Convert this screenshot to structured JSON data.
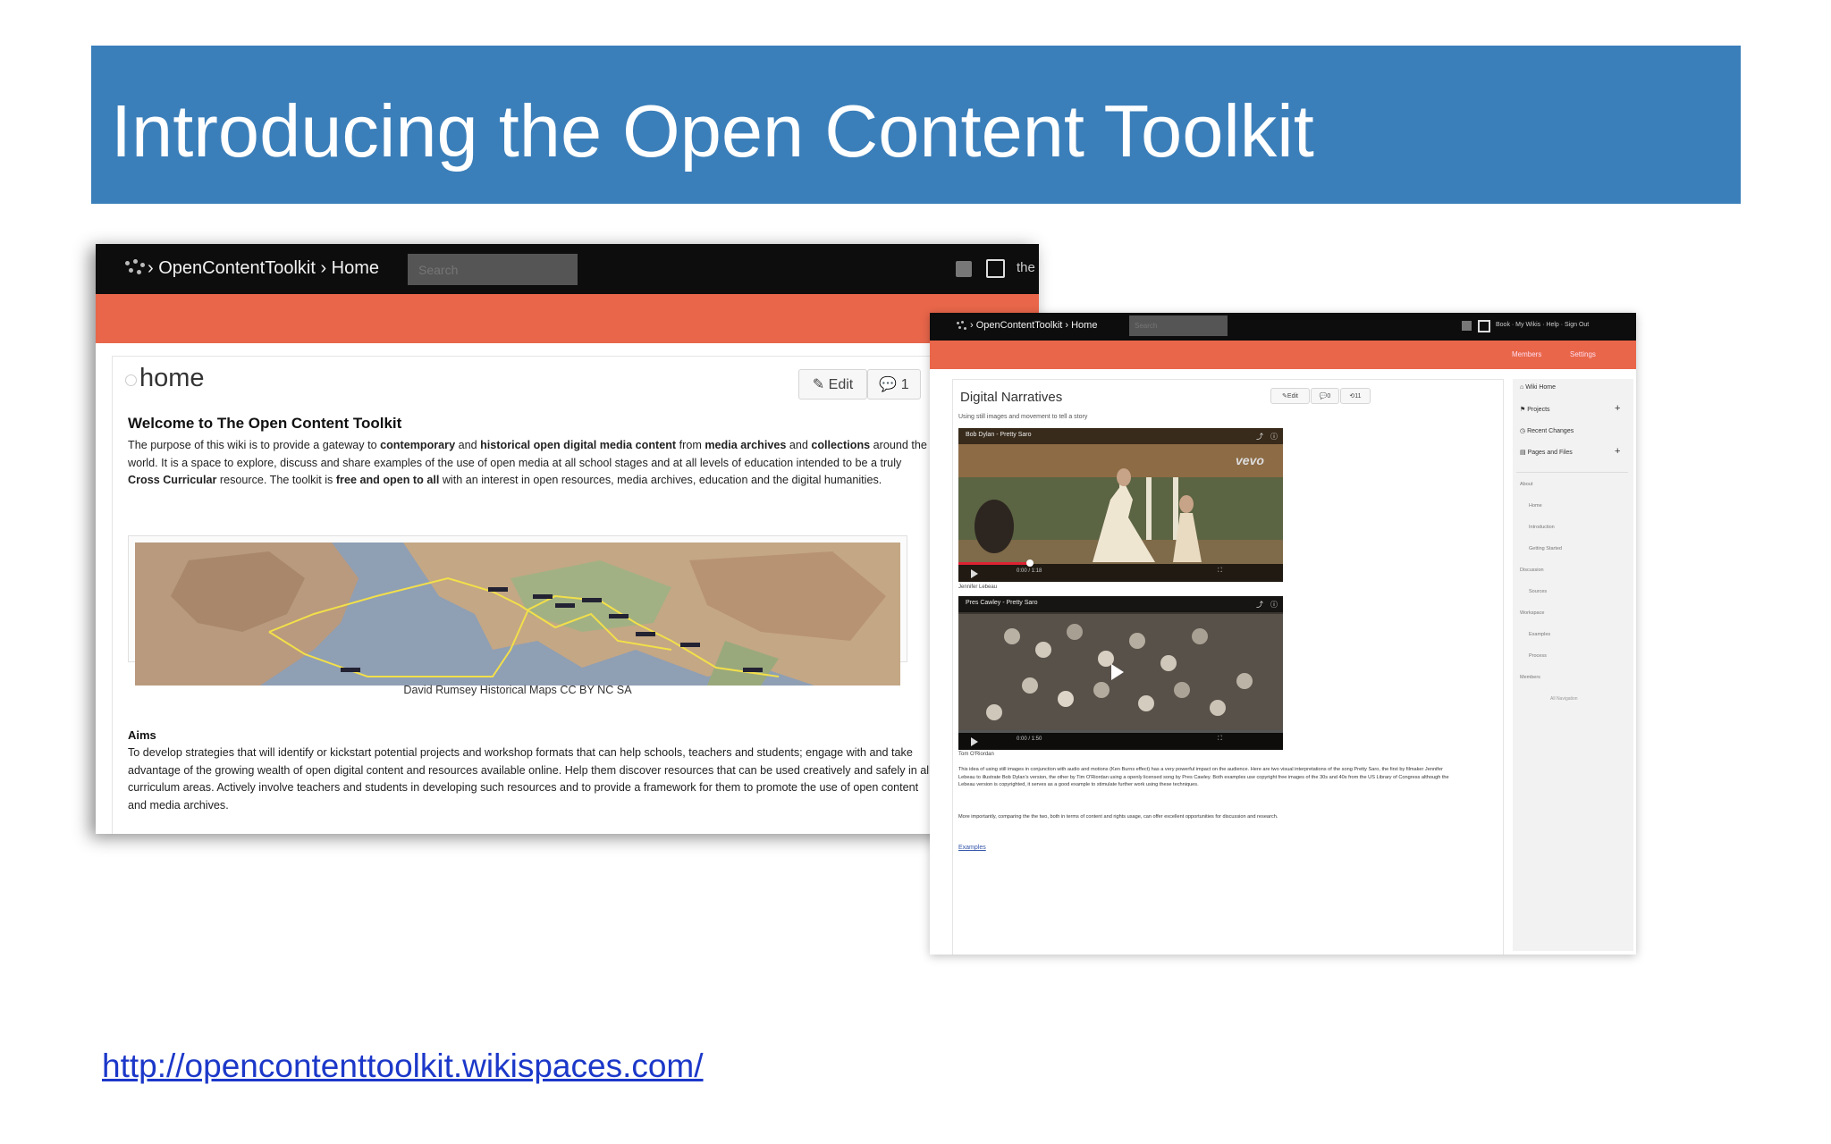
{
  "slide": {
    "title": "Introducing the Open Content Toolkit",
    "link_url": "http://opencontenttoolkit.wikispaces.com/"
  },
  "colors": {
    "title_bar": "#3b7fba",
    "nav_bar": "#0d0d0d",
    "accent_orange": "#e9664a",
    "link_blue": "#1c38c9"
  },
  "screenshot_home": {
    "breadcrumb": "› OpenContentToolkit › Home",
    "search_placeholder": "Search",
    "nav_user": "the",
    "page_title": "home",
    "edit_label": "Edit",
    "comments_count": "1",
    "welcome_heading": "Welcome to The Open Content Toolkit",
    "intro": {
      "p1": "The purpose of this wiki is to provide a gateway to ",
      "b1": "contemporary",
      "p2": " and ",
      "b2": "historical open digital media content",
      "p3": " from ",
      "b3": "media archives",
      "p4": " and ",
      "b4": "collections",
      "p5": " around the world. It is a space to explore, discuss and share examples of the use of open media at all school stages and at all levels of education intended to be a truly ",
      "b5": "Cross Curricular",
      "p6": " resource. The toolkit is ",
      "b6": "free and open to all",
      "p7": " with an interest in open resources, media archives, education and the digital humanities."
    },
    "map_caption": "David Rumsey Historical Maps CC BY NC SA",
    "aims_heading": "Aims",
    "aims_text": "To develop strategies that will identify or kickstart potential projects and workshop formats that can help schools, teachers and students; engage with and take advantage of the growing wealth of open digital content and resources available online. Help them discover resources that can be used creatively and safely in all curriculum areas. Actively involve teachers and students in developing such resources and to provide a framework for them to promote the use of open content and media archives."
  },
  "screenshot_narratives": {
    "breadcrumb": "› OpenContentToolkit › Home",
    "search_placeholder": "Search",
    "nav_links": "Book · My Wikis · Help · Sign Out",
    "orange_links": [
      "Members",
      "Settings"
    ],
    "page_title": "Digital Narratives",
    "subtitle": "Using still images and movement to tell a story",
    "edit_label": "Edit",
    "comments_count": "0",
    "history_count": "11",
    "video1": {
      "title": "Bob Dylan - Pretty Saro",
      "time": "0:00 / 1:18",
      "watermark": "vevo",
      "credit": "Jennifer Lebeau"
    },
    "video2": {
      "title": "Pres Cawley - Pretty Saro",
      "time": "0:00 / 1:50",
      "credit": "Tom O'Riordan"
    },
    "body_text1": "This idea of using still images in conjunction with audio and motions (Ken Burns effect) has a very powerful impact on the audience. Here are two visual interpretations of the song Pretty Saro, the first by filmaker Jennifer Lebeau to illustrate Bob Dylan's version, the other by Tim O'Riordan using a openly licensed song by Pres Cawley. Both examples use copyright free images of the 30s and 40s from the US Library of Congress although the Lebeau version is copyrighted, it serves as a good example to stimulate further work using these techniques.",
    "body_text2": "More importantly, comparing the the two, both in terms of content and rights usage, can offer excellent opportunities for discussion and research.",
    "examples_link": "Examples",
    "sidebar_main": [
      "Wiki Home",
      "Projects",
      "Recent Changes",
      "Pages and Files"
    ],
    "sidebar_tree": [
      "About",
      "Home",
      "Introduction",
      "Getting Started",
      "Discussion",
      "Sources",
      "Workspace",
      "Examples",
      "Process",
      "Members",
      "All Navigation"
    ]
  }
}
